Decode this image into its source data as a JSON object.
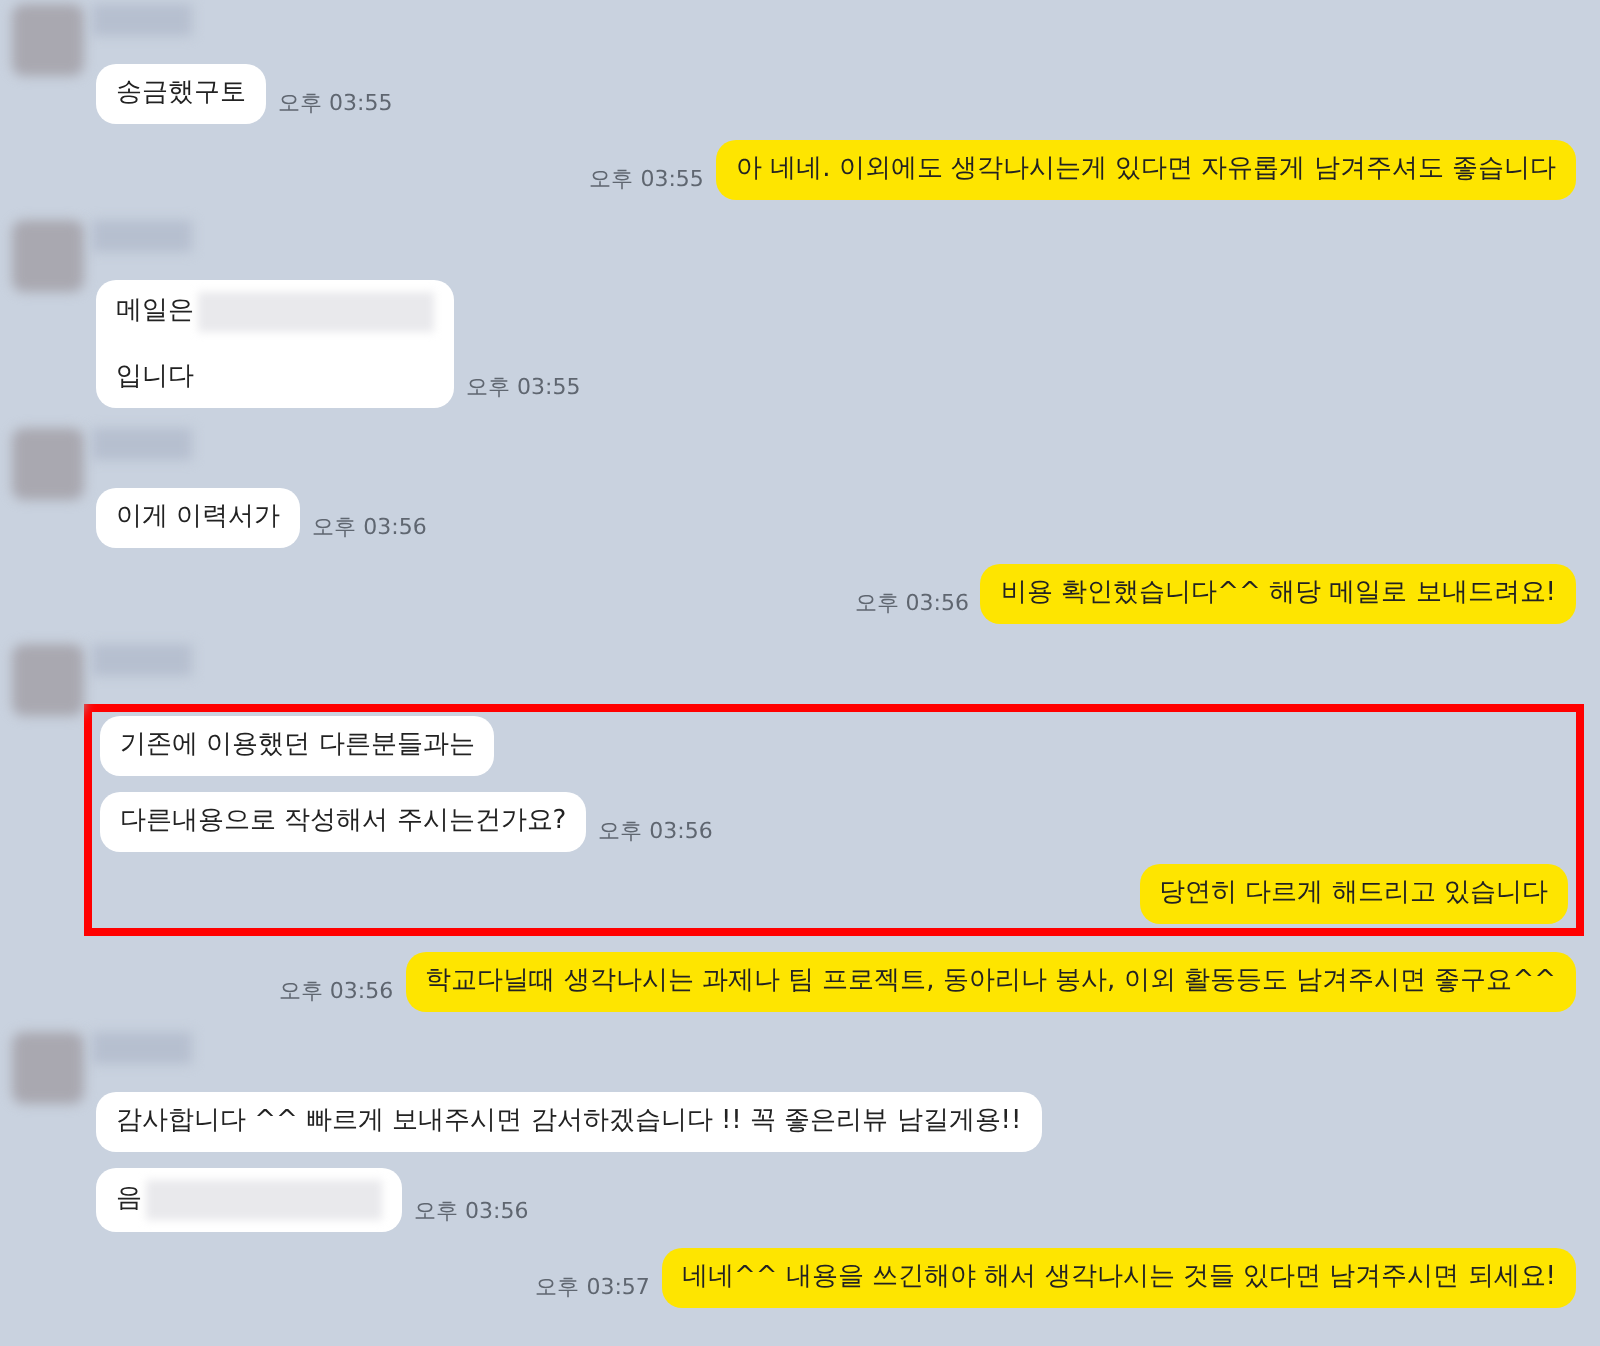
{
  "chat": [
    {
      "kind": "sender"
    },
    {
      "kind": "received",
      "messages": [
        {
          "lines": [
            "송금했구토"
          ],
          "redacted": false
        }
      ],
      "time": "오후 03:55"
    },
    {
      "kind": "sent",
      "text": "아 네네. 이외에도 생각나시는게 있다면 자유롭게 남겨주셔도 좋습니다",
      "time": "오후 03:55"
    },
    {
      "kind": "sender"
    },
    {
      "kind": "received",
      "messages": [
        {
          "lines": [
            "메일은",
            "입니다"
          ],
          "redacted": true
        }
      ],
      "time": "오후 03:55"
    },
    {
      "kind": "sender"
    },
    {
      "kind": "received",
      "messages": [
        {
          "lines": [
            "이게 이력서가"
          ],
          "redacted": false
        }
      ],
      "time": "오후 03:56"
    },
    {
      "kind": "sent",
      "text": "비용 확인했습니다^^ 해당 메일로 보내드려요!",
      "time": "오후 03:56"
    },
    {
      "kind": "sender"
    },
    {
      "kind": "highlight",
      "items": [
        {
          "kind": "received",
          "messages": [
            {
              "lines": [
                "기존에 이용했던 다른분들과는"
              ],
              "redacted": false
            },
            {
              "lines": [
                "다른내용으로 작성해서 주시는건가요?"
              ],
              "redacted": false
            }
          ],
          "time": "오후 03:56"
        },
        {
          "kind": "sent",
          "text": "당연히 다르게 해드리고 있습니다"
        }
      ]
    },
    {
      "kind": "sent",
      "text": "학교다닐때 생각나시는 과제나 팀 프로젝트, 동아리나 봉사, 이외 활동등도 남겨주시면 좋구요^^",
      "time": "오후 03:56"
    },
    {
      "kind": "sender"
    },
    {
      "kind": "received",
      "messages": [
        {
          "lines": [
            "감사합니다 ^^ 빠르게 보내주시면 감서하겠습니다 !! 꼭 좋은리뷰 남길게용!!"
          ],
          "redacted": false
        },
        {
          "lines": [
            "음"
          ],
          "redacted": true
        }
      ],
      "time": "오후 03:56"
    },
    {
      "kind": "sent",
      "text": "네네^^ 내용을 쓰긴해야 해서 생각나시는 것들 있다면 남겨주시면 되세요!",
      "time": "오후 03:57"
    }
  ]
}
